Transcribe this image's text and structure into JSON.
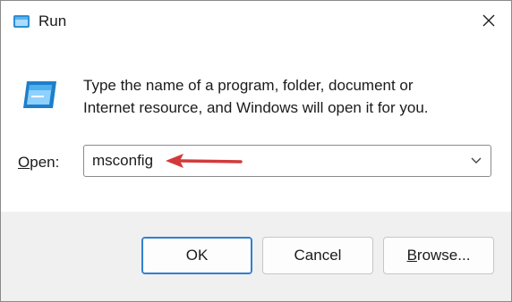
{
  "window": {
    "title": "Run",
    "icon": "run-icon",
    "close_icon": "close-icon"
  },
  "content": {
    "icon": "run-dialog-icon",
    "description_line1": "Type the name of a program, folder, document or",
    "description_line2": "Internet resource, and Windows will open it for you.",
    "open_label_accel": "O",
    "open_label_rest": "pen:",
    "open_value": "msconfig",
    "dropdown_icon": "chevron-down-icon",
    "annotation": "red-arrow-icon"
  },
  "buttons": {
    "ok": "OK",
    "cancel": "Cancel",
    "browse_accel": "B",
    "browse_rest": "rowse..."
  },
  "colors": {
    "accent": "#2f7fd1",
    "annotation": "#d23a3a",
    "footer_bg": "#f0f0f0"
  }
}
